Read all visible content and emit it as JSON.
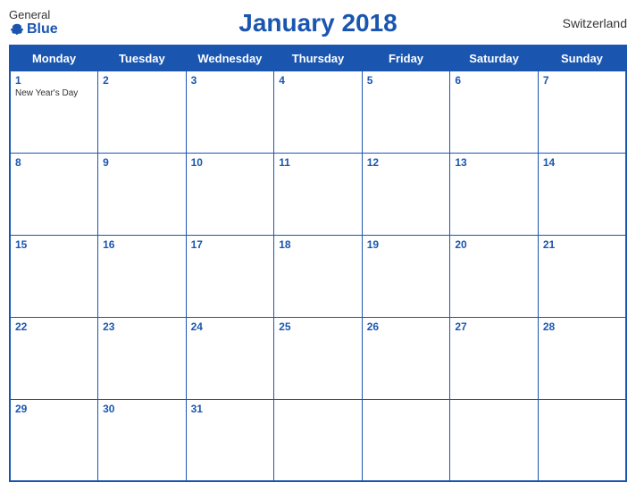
{
  "header": {
    "title": "January 2018",
    "country": "Switzerland",
    "logo_general": "General",
    "logo_blue": "Blue"
  },
  "weekdays": [
    "Monday",
    "Tuesday",
    "Wednesday",
    "Thursday",
    "Friday",
    "Saturday",
    "Sunday"
  ],
  "weeks": [
    [
      {
        "day": "1",
        "holiday": "New Year's Day"
      },
      {
        "day": "2",
        "holiday": ""
      },
      {
        "day": "3",
        "holiday": ""
      },
      {
        "day": "4",
        "holiday": ""
      },
      {
        "day": "5",
        "holiday": ""
      },
      {
        "day": "6",
        "holiday": ""
      },
      {
        "day": "7",
        "holiday": ""
      }
    ],
    [
      {
        "day": "8",
        "holiday": ""
      },
      {
        "day": "9",
        "holiday": ""
      },
      {
        "day": "10",
        "holiday": ""
      },
      {
        "day": "11",
        "holiday": ""
      },
      {
        "day": "12",
        "holiday": ""
      },
      {
        "day": "13",
        "holiday": ""
      },
      {
        "day": "14",
        "holiday": ""
      }
    ],
    [
      {
        "day": "15",
        "holiday": ""
      },
      {
        "day": "16",
        "holiday": ""
      },
      {
        "day": "17",
        "holiday": ""
      },
      {
        "day": "18",
        "holiday": ""
      },
      {
        "day": "19",
        "holiday": ""
      },
      {
        "day": "20",
        "holiday": ""
      },
      {
        "day": "21",
        "holiday": ""
      }
    ],
    [
      {
        "day": "22",
        "holiday": ""
      },
      {
        "day": "23",
        "holiday": ""
      },
      {
        "day": "24",
        "holiday": ""
      },
      {
        "day": "25",
        "holiday": ""
      },
      {
        "day": "26",
        "holiday": ""
      },
      {
        "day": "27",
        "holiday": ""
      },
      {
        "day": "28",
        "holiday": ""
      }
    ],
    [
      {
        "day": "29",
        "holiday": ""
      },
      {
        "day": "30",
        "holiday": ""
      },
      {
        "day": "31",
        "holiday": ""
      },
      {
        "day": "",
        "holiday": ""
      },
      {
        "day": "",
        "holiday": ""
      },
      {
        "day": "",
        "holiday": ""
      },
      {
        "day": "",
        "holiday": ""
      }
    ]
  ]
}
